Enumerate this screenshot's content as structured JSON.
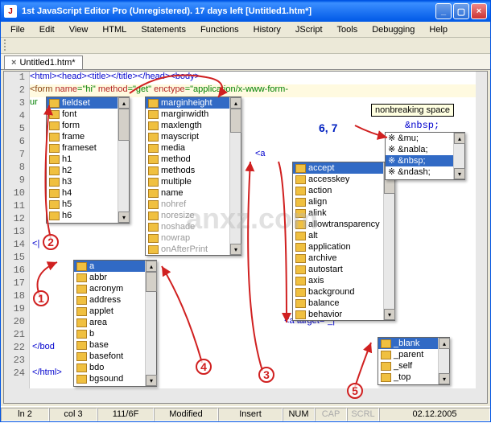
{
  "window": {
    "title": "1st JavaScript Editor Pro  (Unregistered). 17 days left     [Untitled1.htm*]"
  },
  "menu": [
    "File",
    "Edit",
    "View",
    "HTML",
    "Statements",
    "Functions",
    "History",
    "JScript",
    "Tools",
    "Debugging",
    "Help"
  ],
  "tab": {
    "label": "Untitled1.htm*"
  },
  "lines": [
    "1",
    "2",
    "3",
    "4",
    "5",
    "6",
    "7",
    "8",
    "9",
    "10",
    "11",
    "12",
    "13",
    "14",
    "15",
    "16",
    "17",
    "18",
    "19",
    "20",
    "21",
    "22",
    "23",
    "24"
  ],
  "code": {
    "l1": "<html><head><title></title></head><body>",
    "l2_form": "<form",
    "l2_name": " name",
    "l2_nameval": "=\"hi\"",
    "l2_method": " method",
    "l2_methodval": "=\"get\"",
    "l2_enctype": " enctype",
    "l2_enctypeval": "=\"application/x-www-form-",
    "l3": "ur",
    "l14": " <|",
    "l22a": " </bod",
    "l24": " </html>",
    "atag": "<a",
    "atarget": "  <a target=\"_|\""
  },
  "popup1": [
    "fieldset",
    "font",
    "form",
    "frame",
    "frameset",
    "h1",
    "h2",
    "h3",
    "h4",
    "h5",
    "h6"
  ],
  "popup2": [
    "marginheight",
    "marginwidth",
    "maxlength",
    "mayscript",
    "media",
    "method",
    "methods",
    "multiple",
    "name",
    "nohref",
    "noresize",
    "noshade",
    "nowrap",
    "onAfterPrint"
  ],
  "popup3": [
    "a",
    "abbr",
    "acronym",
    "address",
    "applet",
    "area",
    "b",
    "base",
    "basefont",
    "bdo",
    "bgsound"
  ],
  "popup4": [
    "accept",
    "accesskey",
    "action",
    "align",
    "alink",
    "allowtransparency",
    "alt",
    "application",
    "archive",
    "autostart",
    "axis",
    "background",
    "balance",
    "behavior"
  ],
  "popup5": [
    "_blank",
    "_parent",
    "_self",
    "_top"
  ],
  "entities": {
    "list": [
      "※ &mu;",
      "※ &nabla;",
      "※ &nbsp;",
      "※ &ndash;"
    ],
    "selIndex": 2,
    "highlight": "&nbsp;"
  },
  "tooltip": "nonbreaking space",
  "annots": {
    "a1": "1",
    "a2": "2",
    "a3": "3",
    "a4": "4",
    "a5": "5",
    "a67": "6, 7"
  },
  "status": {
    "ln": "ln 2",
    "col": "col 3",
    "pos": "111/6F",
    "mod": "Modified",
    "mode": "Insert",
    "num": "NUM",
    "cap": "CAP",
    "scrl": "SCRL",
    "date": "02.12.2005"
  },
  "watermark": "anxz.com"
}
